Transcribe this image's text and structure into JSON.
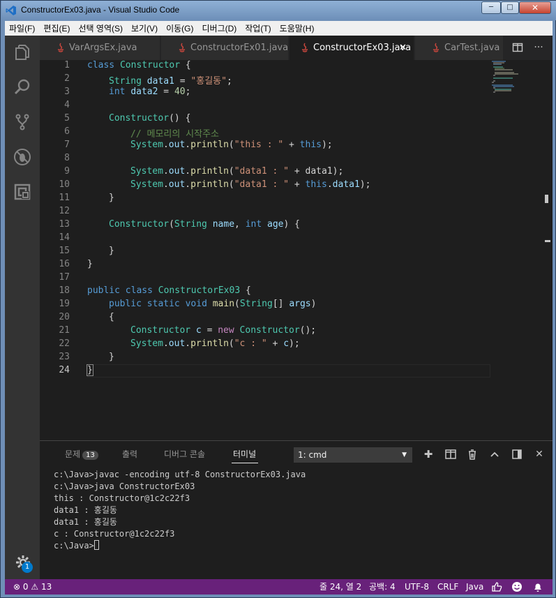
{
  "window": {
    "title": "ConstructorEx03.java - Visual Studio Code",
    "min": "─",
    "max": "□",
    "close": "✕"
  },
  "menu": [
    "파일(F)",
    "편집(E)",
    "선택 영역(S)",
    "보기(V)",
    "이동(G)",
    "디버그(D)",
    "작업(T)",
    "도움말(H)"
  ],
  "tabs": [
    {
      "label": "VarArgsEx.java",
      "active": false
    },
    {
      "label": "ConstructorEx01.java",
      "active": false
    },
    {
      "label": "ConstructorEx03.java",
      "active": true
    },
    {
      "label": "CarTest.java",
      "active": false
    }
  ],
  "tab_close": "✕",
  "editor": {
    "line_numbers": [
      "1",
      "2",
      "3",
      "4",
      "5",
      "6",
      "7",
      "8",
      "9",
      "10",
      "11",
      "12",
      "13",
      "14",
      "15",
      "16",
      "17",
      "18",
      "19",
      "20",
      "21",
      "22",
      "23",
      "24"
    ],
    "current_line": "24",
    "code": {
      "l1": [
        "class",
        "Constructor",
        " {"
      ],
      "l2": [
        "String",
        "data1",
        " = ",
        "\"홍길동\"",
        ";"
      ],
      "l3": [
        "int",
        "data2",
        " = ",
        "40",
        ";"
      ],
      "l5": [
        "Constructor",
        "() {"
      ],
      "l6": [
        "// 메모리의 시작주소"
      ],
      "l7": [
        "System",
        ".",
        "out",
        ".",
        "println",
        "(",
        "\"this : \"",
        " + ",
        "this",
        ");"
      ],
      "l9": [
        "System",
        ".",
        "out",
        ".",
        "println",
        "(",
        "\"data1 : \"",
        " + ",
        "data1",
        ");"
      ],
      "l10": [
        "System",
        ".",
        "out",
        ".",
        "println",
        "(",
        "\"data1 : \"",
        " + ",
        "this",
        ".",
        "data1",
        ");"
      ],
      "l11": [
        "}"
      ],
      "l13": [
        "Constructor",
        "(",
        "String",
        " ",
        "name",
        ", ",
        "int",
        " ",
        "age",
        ") {"
      ],
      "l15": [
        "}"
      ],
      "l16": [
        "}"
      ],
      "l18": [
        "public",
        " ",
        "class",
        " ",
        "ConstructorEx03",
        " {"
      ],
      "l19": [
        "public",
        " ",
        "static",
        " ",
        "void",
        " ",
        "main",
        "(",
        "String",
        "[] ",
        "args",
        ")"
      ],
      "l20": [
        "{"
      ],
      "l21": [
        "Constructor",
        " ",
        "c",
        " = ",
        "new",
        " ",
        "Constructor",
        "();"
      ],
      "l22": [
        "System",
        ".",
        "out",
        ".",
        "println",
        "(",
        "\"c : \"",
        " + ",
        "c",
        ");"
      ],
      "l23": [
        "}"
      ],
      "l24": [
        "}"
      ]
    }
  },
  "panel": {
    "tabs": {
      "problems": "문제",
      "problems_count": "13",
      "output": "출력",
      "debug_console": "디버그 콘솔",
      "terminal": "터미널"
    },
    "terminal_select": "1: cmd",
    "terminal_lines": [
      "c:\\Java>javac -encoding utf-8 ConstructorEx03.java",
      "",
      "c:\\Java>java ConstructorEx03",
      "this : Constructor@1c2c22f3",
      "data1 : 홍길동",
      "data1 : 홍길동",
      "c : Constructor@1c2c22f3",
      "",
      "c:\\Java>"
    ]
  },
  "status": {
    "errors": "0",
    "warnings": "13",
    "position": "줄 24, 열 2",
    "indent": "공백: 4",
    "encoding": "UTF-8",
    "eol": "CRLF",
    "language": "Java",
    "settings_badge": "1"
  },
  "colors": {
    "statusbar": "#68217a",
    "activity": "#333333",
    "editor_bg": "#1e1e1e",
    "keyword": "#569cd6",
    "type": "#4ec9b0",
    "string": "#ce9178"
  }
}
